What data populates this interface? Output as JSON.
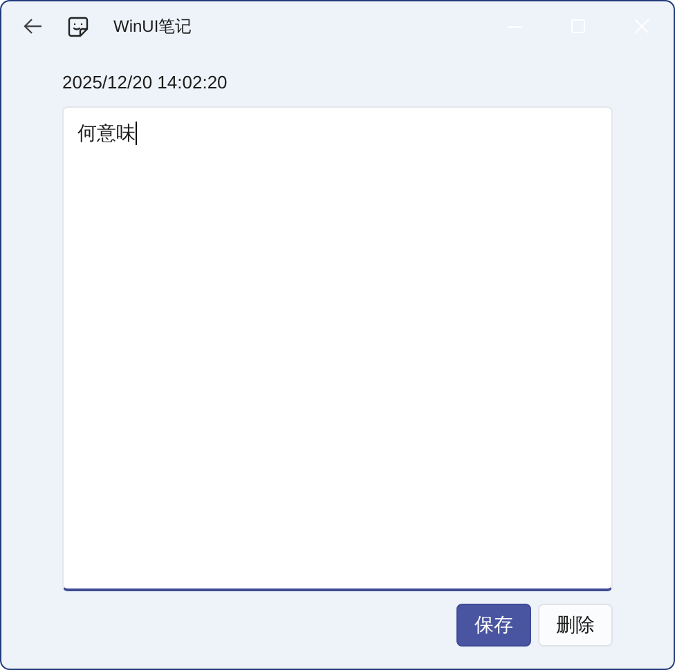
{
  "window": {
    "title": "WinUI笔记"
  },
  "timestamp": "2025/12/20 14:02:20",
  "note": {
    "value": "何意味",
    "focused": true
  },
  "buttons": [
    {
      "label": "保存",
      "kind": "primary"
    },
    {
      "label": "删除",
      "kind": "secondary"
    }
  ]
}
